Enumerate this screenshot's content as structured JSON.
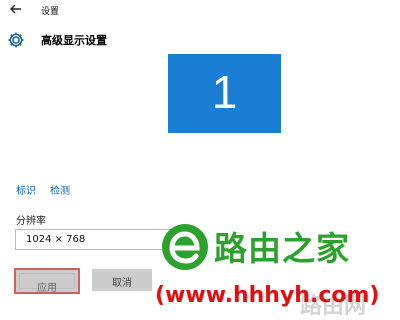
{
  "window": {
    "title": "设置"
  },
  "header": {
    "page_title": "高级显示设置"
  },
  "display": {
    "monitor_number": "1"
  },
  "links": {
    "identify": "标识",
    "detect": "检测"
  },
  "resolution": {
    "label": "分辨率",
    "value": "1024 × 768"
  },
  "buttons": {
    "apply": "应用",
    "cancel": "取消"
  },
  "watermark": {
    "brand": "路由之家",
    "url": "(www.hhhyh.com)",
    "faint": "路由网"
  },
  "colors": {
    "monitor_blue": "#1a7fd4",
    "link_blue": "#0a63b8",
    "apply_highlight": "#d05f5f",
    "watermark_green": "#2ca12e",
    "watermark_red": "#e01010"
  },
  "icons": {
    "back": "back-arrow-icon",
    "settings": "gear-icon",
    "watermark_logo": "e-logo-icon"
  }
}
